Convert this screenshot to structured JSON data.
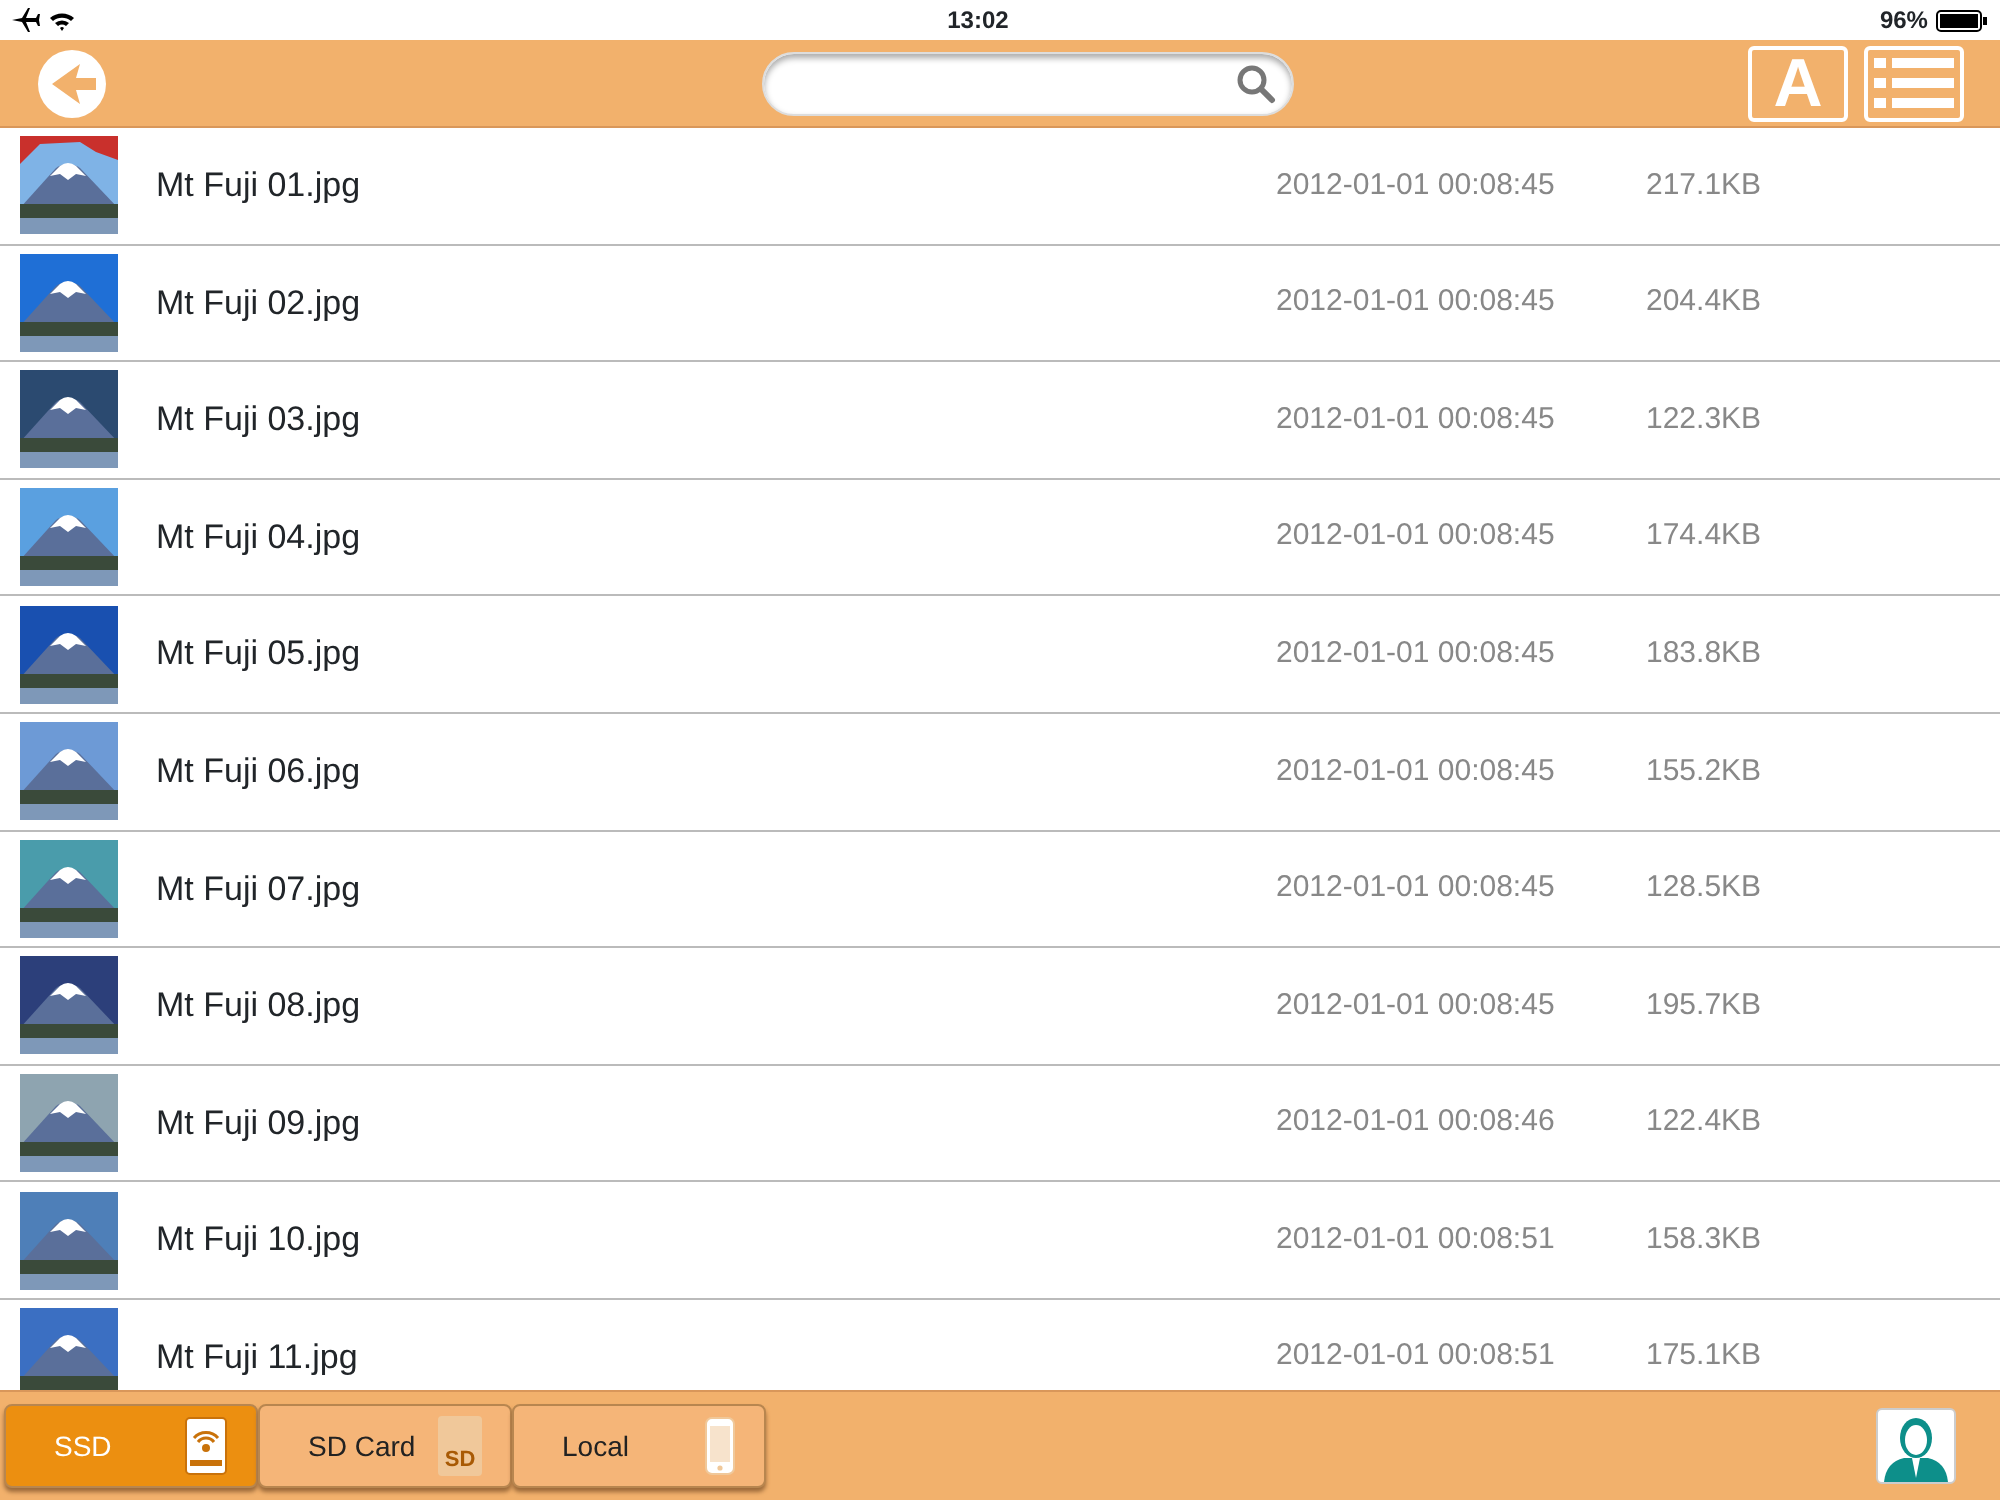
{
  "status_bar": {
    "time": "13:02",
    "battery": "96%"
  },
  "toolbar": {
    "font_button": "A"
  },
  "files": [
    {
      "name": "Mt Fuji 01.jpg",
      "date": "2012-01-01 00:08:45",
      "size": "217.1KB"
    },
    {
      "name": "Mt Fuji 02.jpg",
      "date": "2012-01-01 00:08:45",
      "size": "204.4KB"
    },
    {
      "name": "Mt Fuji 03.jpg",
      "date": "2012-01-01 00:08:45",
      "size": "122.3KB"
    },
    {
      "name": "Mt Fuji 04.jpg",
      "date": "2012-01-01 00:08:45",
      "size": "174.4KB"
    },
    {
      "name": "Mt Fuji 05.jpg",
      "date": "2012-01-01 00:08:45",
      "size": "183.8KB"
    },
    {
      "name": "Mt Fuji 06.jpg",
      "date": "2012-01-01 00:08:45",
      "size": "155.2KB"
    },
    {
      "name": "Mt Fuji 07.jpg",
      "date": "2012-01-01 00:08:45",
      "size": "128.5KB"
    },
    {
      "name": "Mt Fuji 08.jpg",
      "date": "2012-01-01 00:08:45",
      "size": "195.7KB"
    },
    {
      "name": "Mt Fuji 09.jpg",
      "date": "2012-01-01 00:08:46",
      "size": "122.4KB"
    },
    {
      "name": "Mt Fuji 10.jpg",
      "date": "2012-01-01 00:08:51",
      "size": "158.3KB"
    },
    {
      "name": "Mt Fuji 11.jpg",
      "date": "2012-01-01 00:08:51",
      "size": "175.1KB"
    }
  ],
  "storage_tabs": [
    {
      "label": "SSD",
      "kind": "ssd",
      "selected": true
    },
    {
      "label": "SD Card",
      "kind": "sdcard",
      "icon_text": "SD",
      "selected": false
    },
    {
      "label": "Local",
      "kind": "local",
      "selected": false
    }
  ]
}
